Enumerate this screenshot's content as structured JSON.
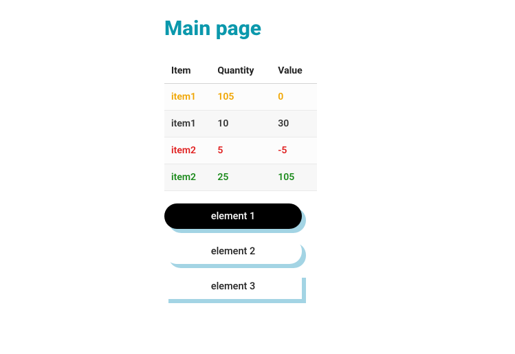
{
  "title": "Main page",
  "table": {
    "headers": [
      "Item",
      "Quantity",
      "Value"
    ],
    "rows": [
      {
        "item": "item1",
        "quantity": "105",
        "value": "0",
        "color": "#f0a500"
      },
      {
        "item": "item1",
        "quantity": "10",
        "value": "30",
        "color": "#333333"
      },
      {
        "item": "item2",
        "quantity": "5",
        "value": "-5",
        "color": "#e02020"
      },
      {
        "item": "item2",
        "quantity": "25",
        "value": "105",
        "color": "#1b8a1b"
      }
    ]
  },
  "buttons": [
    {
      "label": "element 1",
      "variant": "dark"
    },
    {
      "label": "element 2",
      "variant": "light"
    },
    {
      "label": "element 3",
      "variant": "square"
    }
  ]
}
